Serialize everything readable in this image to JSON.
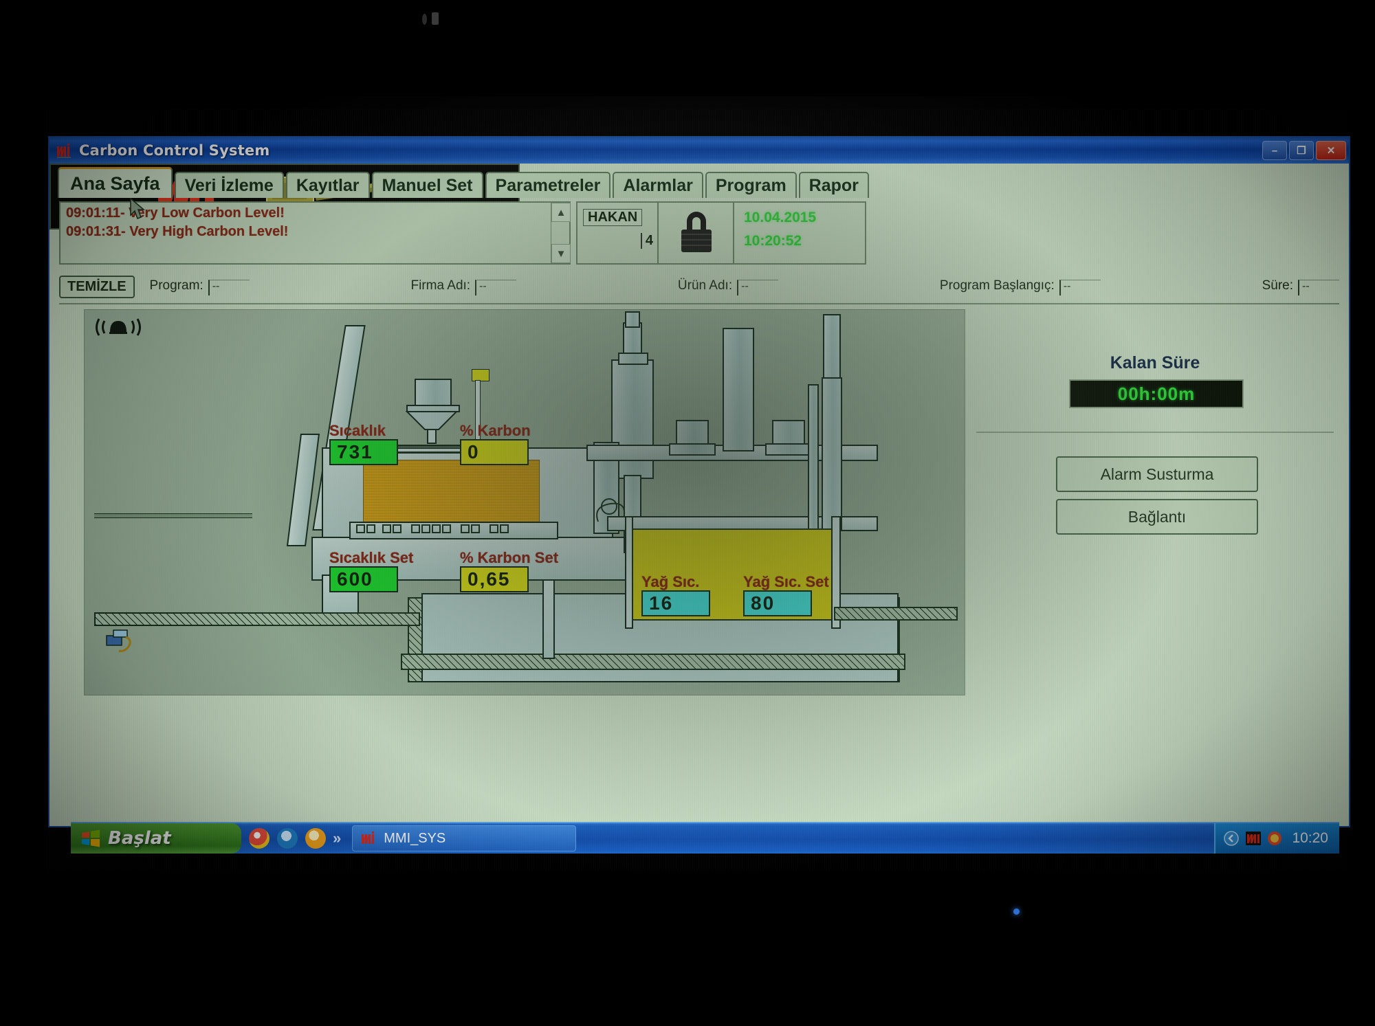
{
  "window": {
    "title": "Carbon Control System",
    "controls": {
      "minimize": "–",
      "restore": "❐",
      "close": "✕"
    }
  },
  "tabs": [
    {
      "label": "Ana Sayfa",
      "active": true
    },
    {
      "label": "Veri İzleme",
      "active": false
    },
    {
      "label": "Kayıtlar",
      "active": false
    },
    {
      "label": "Manuel Set",
      "active": false
    },
    {
      "label": "Parametreler",
      "active": false
    },
    {
      "label": "Alarmlar",
      "active": false
    },
    {
      "label": "Program",
      "active": false
    },
    {
      "label": "Rapor",
      "active": false
    }
  ],
  "alarms": {
    "entries": [
      "09:01:11- Very Low Carbon Level!",
      "09:01:31- Very High Carbon Level!"
    ],
    "scroll_up": "▲",
    "scroll_down": "▼"
  },
  "user": {
    "name": "HAKAN",
    "level": "4"
  },
  "lock": {
    "icon": "padlock-icon"
  },
  "clock": {
    "date": "10.04.2015",
    "time": "10:20:52"
  },
  "brand": {
    "logo_text": "MMi"
  },
  "info_bar": {
    "clear_button": "TEMİZLE",
    "fields": [
      {
        "label": "Program:",
        "value": "--"
      },
      {
        "label": "Firma Adı:",
        "value": "--"
      },
      {
        "label": "Ürün Adı:",
        "value": "--"
      },
      {
        "label": "Program Başlangıç:",
        "value": "--"
      },
      {
        "label": "Süre:",
        "value": "--"
      }
    ]
  },
  "mimic": {
    "alarm_bell": "((●))",
    "readouts": [
      {
        "name": "temperature",
        "caption": "Sıcaklık",
        "value": "731",
        "color": "#18e02c"
      },
      {
        "name": "carbon",
        "caption": "% Karbon",
        "value": "0",
        "color": "#e2e612"
      },
      {
        "name": "temperature-set",
        "caption": "Sıcaklık Set",
        "value": "600",
        "color": "#18e02c"
      },
      {
        "name": "carbon-set",
        "caption": "% Karbon Set",
        "value": "0,65",
        "color": "#e2e612"
      },
      {
        "name": "oil-temp",
        "caption": "Yağ Sıc.",
        "value": "16",
        "color": "#41e8e0"
      },
      {
        "name": "oil-temp-set",
        "caption": "Yağ Sıc. Set",
        "value": "80",
        "color": "#41e8e0"
      }
    ]
  },
  "right_panel": {
    "remaining_label": "Kalan Süre",
    "remaining_value": "00h:00m",
    "buttons": [
      {
        "label": "Alarm Susturma"
      },
      {
        "label": "Bağlantı"
      }
    ]
  },
  "taskbar": {
    "start": "Başlat",
    "overflow": "»",
    "task": "MMI_SYS",
    "clock": "10:20"
  }
}
